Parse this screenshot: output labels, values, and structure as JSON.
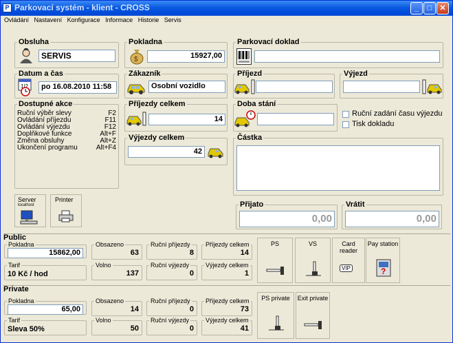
{
  "window": {
    "title": "Parkovací systém - klient - CROSS"
  },
  "menu": {
    "items": [
      "Ovládání",
      "Nastavení",
      "Konfigurace",
      "Informace",
      "Historie",
      "Servis"
    ]
  },
  "obsluha": {
    "label": "Obsluha",
    "value": "SERVIS"
  },
  "pokladna": {
    "label": "Pokladna",
    "value": "15927,00"
  },
  "doklad": {
    "label": "Parkovací doklad"
  },
  "datum": {
    "label": "Datum a čas",
    "value": "po 16.08.2010 11:58"
  },
  "zakaznik": {
    "label": "Zákazník",
    "value": "Osobní vozidlo"
  },
  "prijezd": {
    "label": "Příjezd",
    "value": ""
  },
  "vyjezd": {
    "label": "Výjezd",
    "value": ""
  },
  "akce": {
    "label": "Dostupné akce",
    "items": [
      {
        "name": "Ruční výběr slevy",
        "key": "F2"
      },
      {
        "name": "Ovládání příjezdu",
        "key": "F11"
      },
      {
        "name": "Ovládání výjezdu",
        "key": "F12"
      },
      {
        "name": "Doplňkové funkce",
        "key": "Alt+F"
      },
      {
        "name": "Změna obsluhy",
        "key": "Alt+Z"
      },
      {
        "name": "Ukončení programu",
        "key": "Alt+F4"
      }
    ]
  },
  "prijezdy_celkem": {
    "label": "Příjezdy celkem",
    "value": "14"
  },
  "vyjezdy_celkem": {
    "label": "Výjezdy celkem",
    "value": "42"
  },
  "doba": {
    "label": "Doba stání",
    "value": ""
  },
  "options": {
    "manual": "Ruční zadání času výjezdu",
    "print": "Tisk dokladu"
  },
  "castka": {
    "label": "Částka",
    "value": ""
  },
  "prijato": {
    "label": "Přijato",
    "value": "0,00"
  },
  "vratit": {
    "label": "Vrátit",
    "value": "0,00"
  },
  "server": {
    "label": "Server",
    "host": "localhost"
  },
  "printer": {
    "label": "Printer"
  },
  "public": {
    "label": "Public",
    "pokladna_label": "Pokladna",
    "pokladna": "15862,00",
    "tarif_label": "Tarif",
    "tarif": "10 Kč / hod",
    "obsazeno_label": "Obsazeno",
    "obsazeno": "63",
    "volno_label": "Volno",
    "volno": "137",
    "rucni_prijezdy_label": "Ruční příjezdy",
    "rucni_prijezdy": "8",
    "rucni_vyjezdy_label": "Ruční výjezdy",
    "rucni_vyjezdy": "0",
    "prijezdy_celkem_label": "Příjezdy celkem",
    "prijezdy_celkem": "14",
    "vyjezdy_celkem_label": "Výjezdy celkem",
    "vyjezdy_celkem": "1"
  },
  "private": {
    "label": "Private",
    "pokladna_label": "Pokladna",
    "pokladna": "65,00",
    "tarif_label": "Tarif",
    "tarif": "Sleva 50%",
    "obsazeno_label": "Obsazeno",
    "obsazeno": "14",
    "volno_label": "Volno",
    "volno": "50",
    "rucni_prijezdy_label": "Ruční příjezdy",
    "rucni_prijezdy": "0",
    "rucni_vyjezdy_label": "Ruční výjezdy",
    "rucni_vyjezdy": "0",
    "prijezdy_celkem_label": "Příjezdy celkem",
    "prijezdy_celkem": "73",
    "vyjezdy_celkem_label": "Výjezdy celkem",
    "vyjezdy_celkem": "41"
  },
  "devices": {
    "ps": "PS",
    "vs": "VS",
    "card_reader": "Card reader",
    "card_vip": "VIP",
    "pay_station": "Pay station",
    "ps_private": "PS private",
    "exit_private": "Exit private"
  },
  "colors": {
    "window_bg": "#ece9d8",
    "titlebar": "#0a5ae0",
    "group_border": "#b9b6a8",
    "field_border": "#7f9db9"
  }
}
